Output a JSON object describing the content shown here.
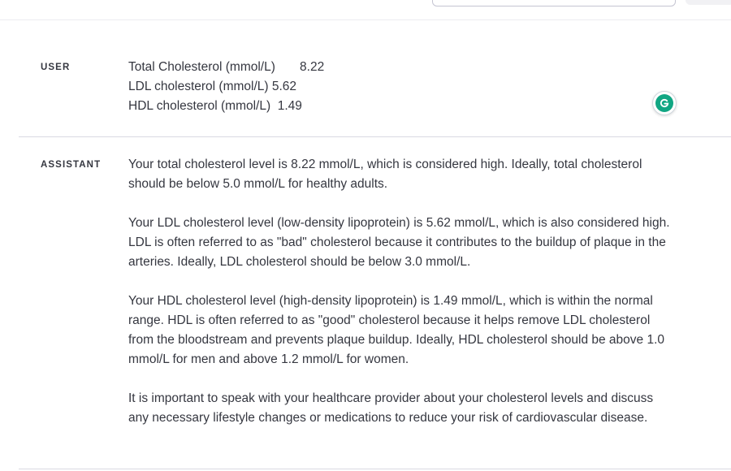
{
  "user_message": {
    "role": "USER",
    "lines": [
      "Total Cholesterol (mmol/L)       8.22",
      "LDL cholesterol (mmol/L) 5.62",
      "HDL cholesterol (mmol/L)  1.49"
    ]
  },
  "assistant_message": {
    "role": "ASSISTANT",
    "paragraphs": [
      "Your total cholesterol level is 8.22 mmol/L, which is considered high. Ideally, total cholesterol should be below 5.0 mmol/L for healthy adults.",
      "Your LDL cholesterol level (low-density lipoprotein) is 5.62 mmol/L, which is also considered high. LDL is often referred to as \"bad\" cholesterol because it contributes to the buildup of plaque in the arteries. Ideally, LDL cholesterol should be below 3.0 mmol/L.",
      "Your HDL cholesterol level (high-density lipoprotein) is 1.49 mmol/L, which is within the normal range. HDL is often referred to as \"good\" cholesterol because it helps remove LDL cholesterol from the bloodstream and prevents plaque buildup. Ideally, HDL cholesterol should be above 1.0 mmol/L for men and above 1.2 mmol/L for women.",
      "It is important to speak with your healthcare provider about your cholesterol levels and discuss any necessary lifestyle changes or medications to reduce your risk of cardiovascular disease."
    ]
  },
  "grammarly": {
    "icon": "grammarly-icon",
    "color": "#11a683"
  }
}
